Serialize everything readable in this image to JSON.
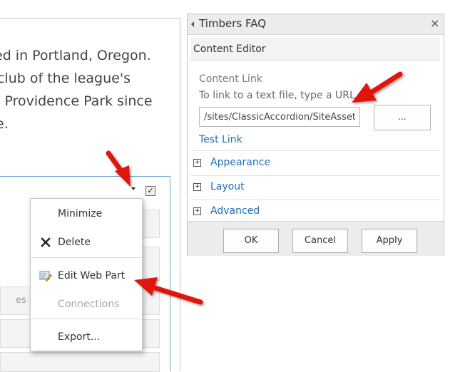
{
  "page": {
    "text_lines": [
      "ed in Portland, Oregon.",
      "club of the league's",
      ": Providence Park since",
      "e."
    ],
    "partial_label": "es"
  },
  "context_menu": {
    "items": [
      {
        "label": "Minimize",
        "icon": "",
        "enabled": true
      },
      {
        "label": "Delete",
        "icon": "close-x-icon",
        "enabled": true
      },
      {
        "label": "Edit Web Part",
        "icon": "edit-web-part-icon",
        "enabled": true
      },
      {
        "label": "Connections",
        "icon": "",
        "enabled": false
      },
      {
        "label": "Export...",
        "icon": "",
        "enabled": true
      }
    ]
  },
  "tool_pane": {
    "title": "Timbers FAQ",
    "close_glyph": "×",
    "editor_title": "Content Editor",
    "content_link_label": "Content Link",
    "content_link_hint": "To link to a text file, type a URL.",
    "content_link_value": "/sites/ClassicAccordion/SiteAssets",
    "browse_label": "...",
    "test_link": "Test Link",
    "sections": [
      {
        "label": "Appearance",
        "expander": "+"
      },
      {
        "label": "Layout",
        "expander": "+"
      },
      {
        "label": "Advanced",
        "expander": "+"
      }
    ],
    "buttons": {
      "ok": "OK",
      "cancel": "Cancel",
      "apply": "Apply"
    }
  },
  "colors": {
    "link_blue": "#1b6eb5",
    "annotation_red": "#e0130f",
    "zone_border": "#6fa3d9"
  }
}
